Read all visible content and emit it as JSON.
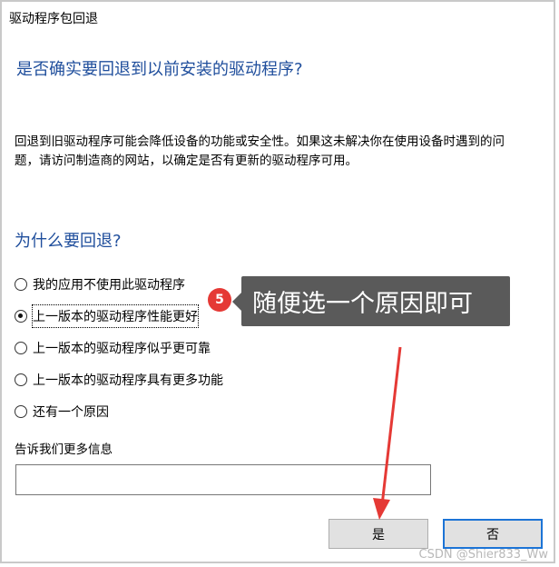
{
  "window": {
    "title": "驱动程序包回退"
  },
  "dialog": {
    "heading": "是否确实要回退到以前安装的驱动程序?",
    "description": "回退到旧驱动程序可能会降低设备的功能或安全性。如果这未解决你在使用设备时遇到的问题，请访问制造商的网站，以确定是否有更新的驱动程序可用。",
    "reason_heading": "为什么要回退?",
    "options": [
      {
        "label": "我的应用不使用此驱动程序",
        "checked": false
      },
      {
        "label": "上一版本的驱动程序性能更好",
        "checked": true
      },
      {
        "label": "上一版本的驱动程序似乎更可靠",
        "checked": false
      },
      {
        "label": "上一版本的驱动程序具有更多功能",
        "checked": false
      },
      {
        "label": "还有一个原因",
        "checked": false
      }
    ],
    "more_info_label": "告诉我们更多信息",
    "more_info_value": "",
    "yes_label": "是",
    "no_label": "否"
  },
  "annotation": {
    "step_number": "5",
    "tooltip_text": "随便选一个原因即可",
    "badge_color": "#e53935",
    "arrow_color": "#e53935"
  },
  "watermark": {
    "text": "CSDN @Shier833_Ww"
  }
}
